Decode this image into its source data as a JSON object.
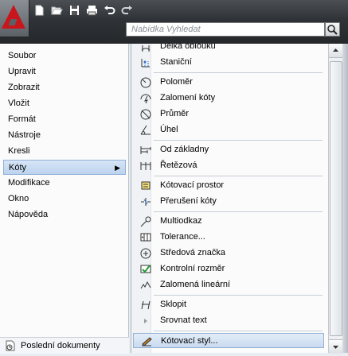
{
  "search": {
    "placeholder": "Nabídka Vyhledat"
  },
  "toolbar": {
    "icons": [
      "new-icon",
      "open-icon",
      "save-icon",
      "print-icon",
      "undo-icon",
      "redo-icon"
    ]
  },
  "menu": {
    "items": [
      {
        "label": "Soubor"
      },
      {
        "label": "Upravit"
      },
      {
        "label": "Zobrazit"
      },
      {
        "label": "Vložit"
      },
      {
        "label": "Formát"
      },
      {
        "label": "Nástroje"
      },
      {
        "label": "Kresli"
      },
      {
        "label": "Kóty",
        "active": true
      },
      {
        "label": "Modifikace"
      },
      {
        "label": "Okno"
      },
      {
        "label": "Nápověda"
      }
    ],
    "recent_label": "Poslední dokumenty"
  },
  "submenu": {
    "items": [
      {
        "label": "Délka oblouku"
      },
      {
        "label": "Staniční"
      },
      {
        "label": "Poloměr"
      },
      {
        "label": "Zalomení kóty"
      },
      {
        "label": "Průměr"
      },
      {
        "label": "Úhel"
      },
      {
        "label": "Od základny"
      },
      {
        "label": "Řetězová"
      },
      {
        "label": "Kótovací prostor"
      },
      {
        "label": "Přerušení kóty"
      },
      {
        "label": "Multiodkaz"
      },
      {
        "label": "Tolerance..."
      },
      {
        "label": "Středová značka"
      },
      {
        "label": "Kontrolní rozměr"
      },
      {
        "label": "Zalomená lineární"
      },
      {
        "label": "Sklopit"
      },
      {
        "label": "Srovnat text"
      },
      {
        "label": "Kótovací styl...",
        "active": true
      }
    ]
  },
  "colors": {
    "accent": "#c8161d",
    "highlight": "#c9daf0",
    "topbar": "#2f3236"
  }
}
